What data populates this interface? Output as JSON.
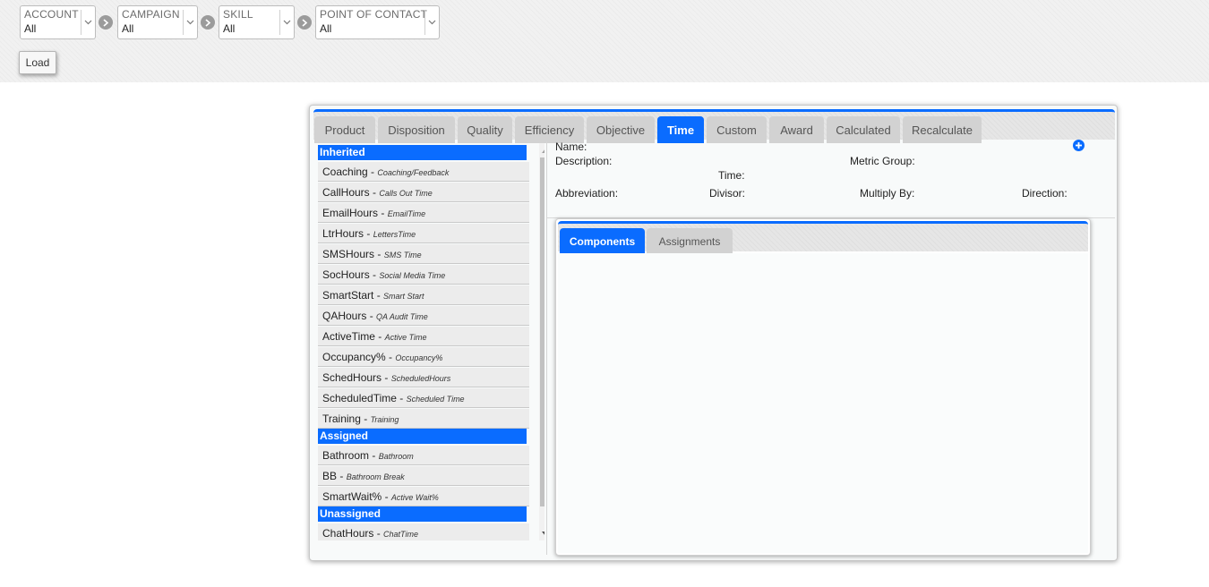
{
  "filters": [
    {
      "label": "ACCOUNT",
      "value": "All"
    },
    {
      "label": "CAMPAIGN",
      "value": "All"
    },
    {
      "label": "SKILL",
      "value": "All"
    },
    {
      "label": "POINT OF CONTACT",
      "value": "All"
    }
  ],
  "load_label": "Load",
  "tabs": [
    "Product",
    "Disposition",
    "Quality",
    "Efficiency",
    "Objective",
    "Time",
    "Custom",
    "Award",
    "Calculated",
    "Recalculate"
  ],
  "active_tab": "Time",
  "list": {
    "groups": [
      {
        "header": "Inherited",
        "items": [
          {
            "name": "Coaching",
            "desc": "Coaching/Feedback"
          },
          {
            "name": "CallHours",
            "desc": "Calls Out Time"
          },
          {
            "name": "EmailHours",
            "desc": "EmailTime"
          },
          {
            "name": "LtrHours",
            "desc": "LettersTime"
          },
          {
            "name": "SMSHours",
            "desc": "SMS Time"
          },
          {
            "name": "SocHours",
            "desc": "Social Media Time"
          },
          {
            "name": "SmartStart",
            "desc": "Smart Start"
          },
          {
            "name": "QAHours",
            "desc": "QA Audit Time"
          },
          {
            "name": "ActiveTime",
            "desc": "Active Time"
          },
          {
            "name": "Occupancy%",
            "desc": "Occupancy%"
          },
          {
            "name": "SchedHours",
            "desc": "ScheduledHours"
          },
          {
            "name": "ScheduledTime",
            "desc": "Scheduled Time"
          },
          {
            "name": "Training",
            "desc": "Training"
          }
        ]
      },
      {
        "header": "Assigned",
        "items": [
          {
            "name": "Bathroom",
            "desc": "Bathroom"
          },
          {
            "name": "BB",
            "desc": "Bathroom Break"
          },
          {
            "name": "SmartWait%",
            "desc": "Active Wait%"
          }
        ]
      },
      {
        "header": "Unassigned",
        "items": [
          {
            "name": "ChatHours",
            "desc": "ChatTime"
          }
        ]
      }
    ],
    "separator": " - "
  },
  "details": {
    "name_label": "Name:",
    "description_label": "Description:",
    "metric_group_label": "Metric Group:",
    "time_label": "Time:",
    "abbreviation_label": "Abbreviation:",
    "divisor_label": "Divisor:",
    "multiply_by_label": "Multiply By:",
    "direction_label": "Direction:"
  },
  "sub_tabs": [
    "Components",
    "Assignments"
  ],
  "active_sub_tab": "Components",
  "colors": {
    "accent": "#0a6cff",
    "tab_inactive": "#d2d2d2"
  },
  "icons": {
    "add": "plus-circle-icon",
    "filter_separator": "chevron-right-circle-icon"
  }
}
